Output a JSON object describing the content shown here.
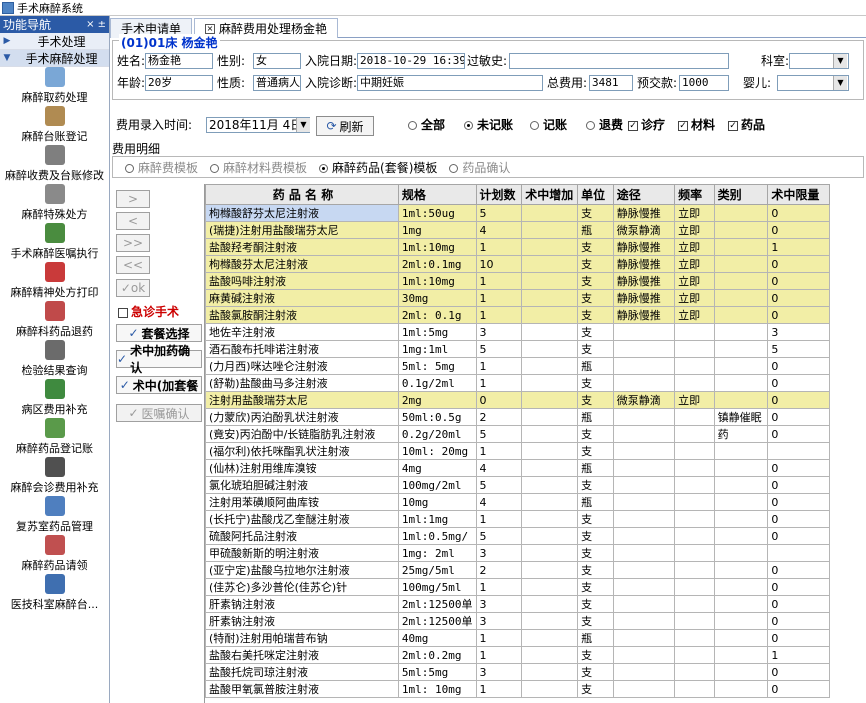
{
  "window": {
    "title": "手术麻醉系统"
  },
  "nav": {
    "header": "功能导航",
    "header_controls": "× ±",
    "groups": [
      {
        "label": "手术处理",
        "arrow": "▶"
      },
      {
        "label": "手术麻醉处理",
        "arrow": "▼"
      }
    ],
    "items": [
      {
        "label": "麻醉取药处理",
        "icon": "syringe-icon",
        "color": "#7aa7d6"
      },
      {
        "label": "麻醉台账登记",
        "icon": "bag-icon",
        "color": "#b08b52"
      },
      {
        "label": "麻醉收费及台账修改",
        "icon": "document-icon",
        "color": "#7f7f7f"
      },
      {
        "label": "麻醉特殊处方",
        "icon": "prescription-icon",
        "color": "#8a8a8a"
      },
      {
        "label": "手术麻醉医嘱执行",
        "icon": "nurse-icon",
        "color": "#4a8c3f"
      },
      {
        "label": "麻醉精神处方打印",
        "icon": "printer-icon",
        "color": "#c93a3a"
      },
      {
        "label": "麻醉科药品退药",
        "icon": "pills-icon",
        "color": "#c04a4a"
      },
      {
        "label": "检验结果查询",
        "icon": "lab-icon",
        "color": "#6b6b6b"
      },
      {
        "label": "病区费用补充",
        "icon": "money-icon",
        "color": "#3f8a3f"
      },
      {
        "label": "麻醉药品登记账",
        "icon": "pill-bottle-icon",
        "color": "#5a9a4a"
      },
      {
        "label": "麻醉会诊费用补充",
        "icon": "notebook-icon",
        "color": "#505050"
      },
      {
        "label": "复苏室药品管理",
        "icon": "calendar-icon",
        "color": "#4f7fbf"
      },
      {
        "label": "麻醉药品请领",
        "icon": "medicine-icon",
        "color": "#c05050"
      },
      {
        "label": "医技科室麻醉台...",
        "icon": "doctor-icon",
        "color": "#3f6fb0"
      }
    ]
  },
  "tabs": [
    {
      "label": "手术申请单",
      "active": false,
      "closable": false
    },
    {
      "label": "麻醉费用处理杨金艳",
      "active": true,
      "closable": true
    }
  ],
  "patient": {
    "legend": "(01)01床  杨金艳",
    "name_label": "姓名:",
    "name_value": "杨金艳",
    "sex_label": "性别:",
    "sex_value": "女",
    "admit_date_label": "入院日期:",
    "admit_date_value": "2018-10-29 16:39",
    "allergy_label": "过敏史:",
    "allergy_value": "",
    "dept_label": "科室:",
    "dept_value": "",
    "age_label": "年龄:",
    "age_value": "20岁",
    "nature_label": "性质:",
    "nature_value": "普通病人",
    "diagnosis_label": "入院诊断:",
    "diagnosis_value": "中期妊娠",
    "total_label": "总费用:",
    "total_value": "3481",
    "deposit_label": "预交款:",
    "deposit_value": "1000",
    "baby_label": "婴儿:",
    "baby_value": ""
  },
  "filter": {
    "time_label": "费用录入时间:",
    "date_value": "2018年11月 4日",
    "refresh_label": "刷新",
    "radios": [
      {
        "label": "全部",
        "on": false
      },
      {
        "label": "未记账",
        "on": true
      },
      {
        "label": "记账",
        "on": false
      },
      {
        "label": "退费",
        "on": false
      }
    ],
    "checks": [
      {
        "label": "诊疗",
        "on": true
      },
      {
        "label": "材料",
        "on": true
      },
      {
        "label": "药品",
        "on": true
      }
    ]
  },
  "details": {
    "title": "费用明细",
    "subtabs": [
      {
        "label": "麻醉费模板",
        "active": false
      },
      {
        "label": "麻醉材料费模板",
        "active": false
      },
      {
        "label": "麻醉药品(套餐)模板",
        "active": true
      },
      {
        "label": "药品确认",
        "active": false
      }
    ]
  },
  "commands": {
    "move_right": ">",
    "move_left": "<",
    "move_all_right": ">>",
    "move_all_left": "<<",
    "ok": "ok",
    "emergency": "急诊手术",
    "package_select": "套餐选择",
    "intraop_add_confirm": "术中加药确认",
    "intraop_package": "术中(加套餐",
    "order_confirm": "医嘱确认"
  },
  "grid": {
    "columns": [
      "药 品 名 称",
      "规格",
      "计划数",
      "术中增加",
      "单位",
      "途径",
      "频率",
      "类别",
      "术中限量"
    ],
    "rows": [
      {
        "name": "枸橼酸舒芬太尼注射液",
        "spec": "1ml:50ug",
        "plan": "5",
        "add": "",
        "unit": "支",
        "route": "静脉慢推",
        "freq": "立即",
        "cat": "",
        "limit": "0",
        "hl": true,
        "sel": true
      },
      {
        "name": "(瑞捷)注射用盐酸瑞芬太尼",
        "spec": "1mg",
        "plan": "4",
        "add": "",
        "unit": "瓶",
        "route": "微泵静滴",
        "freq": "立即",
        "cat": "",
        "limit": "0",
        "hl": true
      },
      {
        "name": "盐酸羟考酮注射液",
        "spec": "1ml:10mg",
        "plan": "1",
        "add": "",
        "unit": "支",
        "route": "静脉慢推",
        "freq": "立即",
        "cat": "",
        "limit": "1",
        "hl": true
      },
      {
        "name": "枸橼酸芬太尼注射液",
        "spec": "2ml:0.1mg",
        "plan": "10",
        "add": "",
        "unit": "支",
        "route": "静脉慢推",
        "freq": "立即",
        "cat": "",
        "limit": "0",
        "hl": true
      },
      {
        "name": "盐酸吗啡注射液",
        "spec": "1ml:10mg",
        "plan": "1",
        "add": "",
        "unit": "支",
        "route": "静脉慢推",
        "freq": "立即",
        "cat": "",
        "limit": "0",
        "hl": true
      },
      {
        "name": "麻黄碱注射液",
        "spec": "30mg",
        "plan": "1",
        "add": "",
        "unit": "支",
        "route": "静脉慢推",
        "freq": "立即",
        "cat": "",
        "limit": "0",
        "hl": true
      },
      {
        "name": "盐酸氯胺酮注射液",
        "spec": "2ml: 0.1g",
        "plan": "1",
        "add": "",
        "unit": "支",
        "route": "静脉慢推",
        "freq": "立即",
        "cat": "",
        "limit": "0",
        "hl": true
      },
      {
        "name": "地佐辛注射液",
        "spec": "1ml:5mg",
        "plan": "3",
        "add": "",
        "unit": "支",
        "route": "",
        "freq": "",
        "cat": "",
        "limit": "3",
        "hl": false
      },
      {
        "name": "酒石酸布托啡诺注射液",
        "spec": "1mg:1ml",
        "plan": "5",
        "add": "",
        "unit": "支",
        "route": "",
        "freq": "",
        "cat": "",
        "limit": "5",
        "hl": false
      },
      {
        "name": "(力月西)咪达唑仑注射液",
        "spec": "5ml: 5mg",
        "plan": "1",
        "add": "",
        "unit": "瓶",
        "route": "",
        "freq": "",
        "cat": "",
        "limit": "0",
        "hl": false
      },
      {
        "name": "(舒勒)盐酸曲马多注射液",
        "spec": "0.1g/2ml",
        "plan": "1",
        "add": "",
        "unit": "支",
        "route": "",
        "freq": "",
        "cat": "",
        "limit": "0",
        "hl": false
      },
      {
        "name": "注射用盐酸瑞芬太尼",
        "spec": "2mg",
        "plan": "0",
        "add": "",
        "unit": "支",
        "route": "微泵静滴",
        "freq": "立即",
        "cat": "",
        "limit": "0",
        "hl": true
      },
      {
        "name": "(力蒙欣)丙泊酚乳状注射液",
        "spec": "50ml:0.5g",
        "plan": "2",
        "add": "",
        "unit": "瓶",
        "route": "",
        "freq": "",
        "cat": "镇静催眠",
        "limit": "0",
        "hl": false
      },
      {
        "name": "(竟安)丙泊酚中/长链脂肪乳注射液",
        "spec": "0.2g/20ml",
        "plan": "5",
        "add": "",
        "unit": "支",
        "route": "",
        "freq": "",
        "cat": "药",
        "limit": "0",
        "hl": false
      },
      {
        "name": "(福尔利)依托咪酯乳状注射液",
        "spec": "10ml: 20mg",
        "plan": "1",
        "add": "",
        "unit": "支",
        "route": "",
        "freq": "",
        "cat": "",
        "limit": "",
        "hl": false
      },
      {
        "name": "(仙林)注射用维库溴铵",
        "spec": "4mg",
        "plan": "4",
        "add": "",
        "unit": "瓶",
        "route": "",
        "freq": "",
        "cat": "",
        "limit": "0",
        "hl": false
      },
      {
        "name": "氯化琥珀胆碱注射液",
        "spec": "100mg/2ml",
        "plan": "5",
        "add": "",
        "unit": "支",
        "route": "",
        "freq": "",
        "cat": "",
        "limit": "0",
        "hl": false
      },
      {
        "name": "注射用苯磺顺阿曲库铵",
        "spec": "10mg",
        "plan": "4",
        "add": "",
        "unit": "瓶",
        "route": "",
        "freq": "",
        "cat": "",
        "limit": "0",
        "hl": false
      },
      {
        "name": "(长托宁)盐酸戊乙奎醚注射液",
        "spec": "1ml:1mg",
        "plan": "1",
        "add": "",
        "unit": "支",
        "route": "",
        "freq": "",
        "cat": "",
        "limit": "0",
        "hl": false
      },
      {
        "name": "硫酸阿托品注射液",
        "spec": "1ml:0.5mg/",
        "plan": "5",
        "add": "",
        "unit": "支",
        "route": "",
        "freq": "",
        "cat": "",
        "limit": "0",
        "hl": false
      },
      {
        "name": "甲硫酸新斯的明注射液",
        "spec": "1mg: 2ml",
        "plan": "3",
        "add": "",
        "unit": "支",
        "route": "",
        "freq": "",
        "cat": "",
        "limit": "",
        "hl": false
      },
      {
        "name": "(亚宁定)盐酸乌拉地尔注射液",
        "spec": "25mg/5ml",
        "plan": "2",
        "add": "",
        "unit": "支",
        "route": "",
        "freq": "",
        "cat": "",
        "limit": "0",
        "hl": false
      },
      {
        "name": "(佳苏仑)多沙普伦(佳苏仑)针",
        "spec": "100mg/5ml",
        "plan": "1",
        "add": "",
        "unit": "支",
        "route": "",
        "freq": "",
        "cat": "",
        "limit": "0",
        "hl": false
      },
      {
        "name": "肝素钠注射液",
        "spec": "2ml:12500单",
        "plan": "3",
        "add": "",
        "unit": "支",
        "route": "",
        "freq": "",
        "cat": "",
        "limit": "0",
        "hl": false
      },
      {
        "name": "肝素钠注射液",
        "spec": "2ml:12500单",
        "plan": "3",
        "add": "",
        "unit": "支",
        "route": "",
        "freq": "",
        "cat": "",
        "limit": "0",
        "hl": false
      },
      {
        "name": "(特耐)注射用帕瑞昔布钠",
        "spec": "40mg",
        "plan": "1",
        "add": "",
        "unit": "瓶",
        "route": "",
        "freq": "",
        "cat": "",
        "limit": "0",
        "hl": false
      },
      {
        "name": "盐酸右美托咪定注射液",
        "spec": "2ml:0.2mg",
        "plan": "1",
        "add": "",
        "unit": "支",
        "route": "",
        "freq": "",
        "cat": "",
        "limit": "1",
        "hl": false
      },
      {
        "name": "盐酸托烷司琼注射液",
        "spec": "5ml:5mg",
        "plan": "3",
        "add": "",
        "unit": "支",
        "route": "",
        "freq": "",
        "cat": "",
        "limit": "0",
        "hl": false
      },
      {
        "name": "盐酸甲氧氯普胺注射液",
        "spec": "1ml: 10mg",
        "plan": "1",
        "add": "",
        "unit": "支",
        "route": "",
        "freq": "",
        "cat": "",
        "limit": "0",
        "hl": false
      }
    ]
  }
}
